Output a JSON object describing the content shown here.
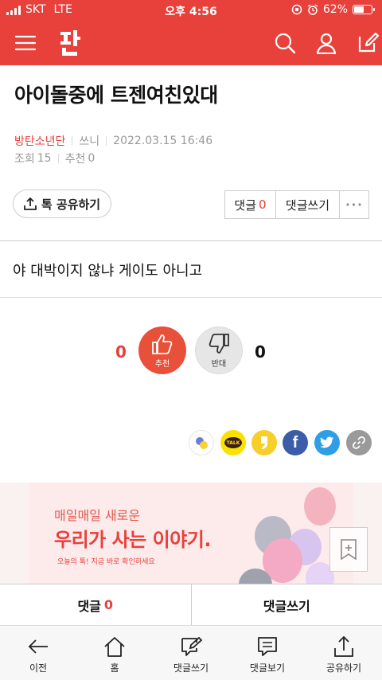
{
  "status_bar": {
    "carrier": "SKT",
    "network": "LTE",
    "time": "오후 4:56",
    "battery": "62%",
    "battery_level": 0.62
  },
  "header": {
    "logo_text": "판",
    "icons": [
      "menu-icon",
      "search-icon",
      "user-icon",
      "edit-icon"
    ]
  },
  "post": {
    "title": "아이돌중에 트젠여친있대",
    "channel": "방탄소년단",
    "author": "쓰니",
    "date": "2022.03.15 16:46",
    "views_label": "조회",
    "views": "15",
    "recommend_label": "추천",
    "recommend": "0",
    "body": "야 대박이지 않냐 게이도 아니고"
  },
  "actions": {
    "share": "톡 공유하기",
    "comments_label": "댓글",
    "comments_count": "0",
    "write_comment": "댓글쓰기",
    "more": "•••"
  },
  "votes": {
    "up_count": "0",
    "up_label": "추천",
    "down_label": "반대",
    "down_count": "0"
  },
  "social": [
    {
      "name": "kakaostory",
      "color": "#ffffff"
    },
    {
      "name": "kakaotalk",
      "label": "TALK",
      "color": "#fae100"
    },
    {
      "name": "quote",
      "color": "#f7cf2a"
    },
    {
      "name": "facebook",
      "label": "f",
      "color": "#3b5ca8"
    },
    {
      "name": "twitter",
      "color": "#2e9ee6"
    },
    {
      "name": "link",
      "color": "#9a9a9a"
    }
  ],
  "banner": {
    "line1": "매일매일 새로운",
    "line2": "우리가 사는 이야기.",
    "line3": "오늘의 톡! 지금 바로 확인하세요"
  },
  "comment_bar": {
    "comments_label": "댓글",
    "comments_count": "0",
    "write": "댓글쓰기"
  },
  "toolbar": [
    {
      "label": "이전",
      "icon": "back-arrow-icon"
    },
    {
      "label": "홈",
      "icon": "home-icon"
    },
    {
      "label": "댓글쓰기",
      "icon": "write-comment-icon"
    },
    {
      "label": "댓글보기",
      "icon": "view-comments-icon"
    },
    {
      "label": "공유하기",
      "icon": "share-icon"
    }
  ]
}
